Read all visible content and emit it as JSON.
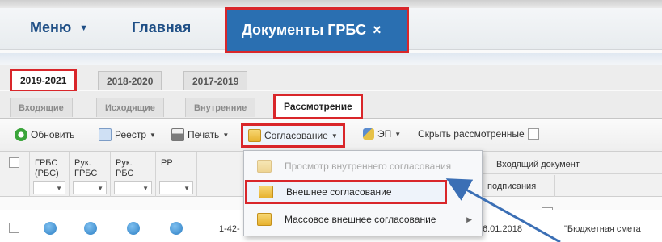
{
  "nav": {
    "menu_label": "Меню",
    "home_label": "Главная",
    "active_label": "Документы ГРБС",
    "close_glyph": "×"
  },
  "year_tabs": [
    "2019-2021",
    "2018-2020",
    "2017-2019"
  ],
  "sub_tabs": [
    "Входящие",
    "Исходящие",
    "Внутренние",
    "Рассмотрение"
  ],
  "toolbar": {
    "refresh": "Обновить",
    "registry": "Реестр",
    "print": "Печать",
    "approval": "Согласование",
    "ep": "ЭП",
    "hide_reviewed": "Скрыть рассмотренные"
  },
  "grid": {
    "columns": [
      "ГРБС\n(РБС)",
      "Рук.\nГРБС",
      "Рук.\nРБС",
      "РР"
    ],
    "incoming_doc": "Входящий документ",
    "signing": "подписания"
  },
  "row": {
    "number": "1-42-",
    "date": "6.01.2018",
    "name": "\"Бюджетная смета"
  },
  "menu": {
    "items": [
      {
        "label": "Просмотр внутреннего согласования",
        "disabled": true
      },
      {
        "label": "Внешнее согласование",
        "highlight": true
      },
      {
        "label": "Массовое внешнее согласование",
        "submenu": true
      }
    ]
  },
  "colors": {
    "accent_blue": "#2a6fb1",
    "highlight_red": "#d9262a",
    "nav_text": "#1f4f86"
  }
}
